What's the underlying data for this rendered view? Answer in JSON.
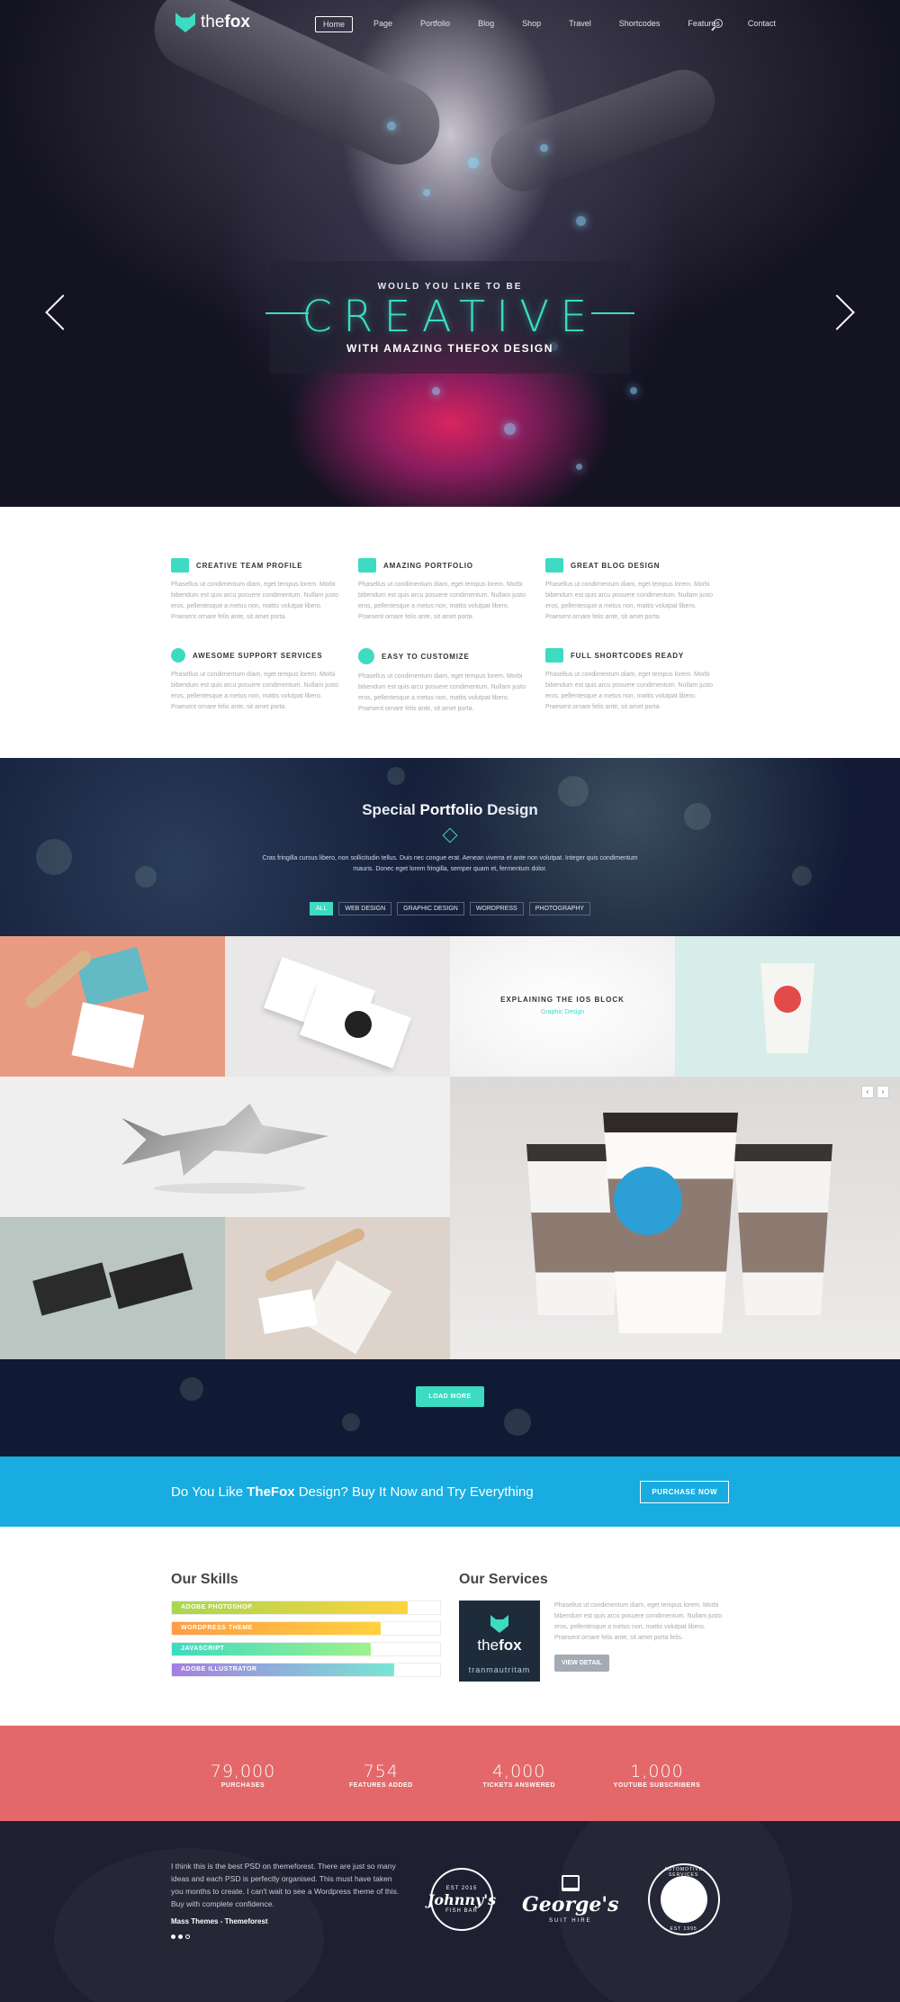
{
  "brand": {
    "logo_text_bold": "the",
    "logo_text": "fox"
  },
  "nav": {
    "items": [
      "Home",
      "Page",
      "Portfolio",
      "Blog",
      "Shop",
      "Travel",
      "Shortcodes",
      "Features",
      "Contact"
    ],
    "active": "Home"
  },
  "hero": {
    "pre_title": "WOULD YOU LIKE TO BE",
    "title": "CREATIVE",
    "subtitle": "WITH AMAZING THEFOX DESIGN"
  },
  "features": [
    {
      "icon": "team-icon",
      "title": "CREATIVE TEAM PROFILE",
      "text": "Phasellus ut condimentum diam, eget tempus lorem. Morbi bibendum est quis arcu posuere condimentum. Nullam justo eros, pellentesque a metus non, mattis volutpat libero. Praesent ornare felis ante, sit amet porta."
    },
    {
      "icon": "cube-icon",
      "title": "AMAZING PORTFOLIO",
      "text": "Phasellus ut condimentum diam, eget tempus lorem. Morbi bibendum est quis arcu posuere condimentum. Nullam justo eros, pellentesque a metus non, mattis volutpat libero. Praesent ornare felis ante, sit amet porta."
    },
    {
      "icon": "camera-icon",
      "title": "GREAT BLOG DESIGN",
      "text": "Phasellus ut condimentum diam, eget tempus lorem. Morbi bibendum est quis arcu posuere condimentum. Nullam justo eros, pellentesque a metus non, mattis volutpat libero. Praesent ornare felis ante, sit amet porta."
    },
    {
      "icon": "magnifier-icon",
      "title": "AWESOME SUPPORT SERVICES",
      "text": "Phasellus ut condimentum diam, eget tempus lorem. Morbi bibendum est quis arcu posuere condimentum. Nullam justo eros, pellentesque a metus non, mattis volutpat libero. Praesent ornare felis ante, sit amet porta."
    },
    {
      "icon": "gear-icon",
      "title": "EASY TO CUSTOMIZE",
      "text": "Phasellus ut condimentum diam, eget tempus lorem. Morbi bibendum est quis arcu posuere condimentum. Nullam justo eros, pellentesque a metus non, mattis volutpat libero. Praesent ornare felis ante, sit amet porta."
    },
    {
      "icon": "chat-icon",
      "title": "FULL SHORTCODES READY",
      "text": "Phasellus ut condimentum diam, eget tempus lorem. Morbi bibendum est quis arcu posuere condimentum. Nullam justo eros, pellentesque a metus non, mattis volutpat libero. Praesent ornare felis ante, sit amet porta."
    }
  ],
  "portfolio": {
    "title_light": "Special ",
    "title_bold": "Portfolio",
    "title_tail": " Design",
    "text": "Cras fringilla cursus libero, non sollicitudin tellus. Duis nec congue erat. Aenean viverra et ante non volutpat. Integer quis condimentum mauris. Donec eget lorem fringilla, semper quam et, fermentum dolor.",
    "filters": [
      "ALL",
      "WEB DESIGN",
      "GRAPHIC DESIGN",
      "WORDPRESS",
      "PHOTOGRAPHY"
    ],
    "active_filter": "ALL",
    "hover_tile": {
      "title": "EXPLAINING THE IOS BLOCK",
      "category": "Graphic Design"
    },
    "load_more": "LOAD MORE"
  },
  "cta": {
    "text_pre": "Do You Like ",
    "text_bold": "TheFox",
    "text_post": " Design? Buy It Now and Try Everything",
    "button": "PURCHASE NOW"
  },
  "skills": {
    "title_light": "Our ",
    "title_bold": "Skills",
    "bars": [
      {
        "label": "ADOBE PHOTOSHOP",
        "percent": 88,
        "from": "#a6d84f",
        "to": "#ffd23f"
      },
      {
        "label": "WORDPRESS THEME",
        "percent": 78,
        "from": "#ff9c45",
        "to": "#ffd23f"
      },
      {
        "label": "JAVASCRIPT",
        "percent": 74,
        "from": "#3ddbc1",
        "to": "#9ff28a"
      },
      {
        "label": "ADOBE ILLUSTRATOR",
        "percent": 83,
        "from": "#a57ee0",
        "to": "#79e6d4"
      }
    ]
  },
  "services": {
    "title_light": "Our ",
    "title_bold": "Services",
    "image_title_light": "the",
    "image_title_bold": "fox",
    "image_tag": "tranmautritam",
    "text": "Phasellus ut condimentum diam, eget tempus lorem. Morbi bibendum est quis arcu posuere condimentum. Nullam justo eros, pellentesque a metus non, mattis volutpat libero. Praesent ornare felis ante, sit amet porta felis.",
    "button": "VIEW DETAIL"
  },
  "stats": [
    {
      "value": "79,000",
      "label": "PURCHASES"
    },
    {
      "value": "754",
      "label": "FEATURES ADDED"
    },
    {
      "value": "4,000",
      "label": "TICKETS ANSWERED"
    },
    {
      "value": "1,000",
      "label": "YOUTUBE SUBSCRIBERS"
    }
  ],
  "testimonial": {
    "quote": "I think this is the best PSD on themeforest. There are just so many ideas and each PSD is perfectly organised. This must have taken you months to create. I can't wait to see a Wordpress theme of this. Buy with complete confidence.",
    "author": "Mass Themes - Themeforest",
    "brands": [
      {
        "name": "Johnny's",
        "sub": "FISH BAR",
        "top": "EST 2015"
      },
      {
        "name": "George's",
        "sub": "SUIT HIRE"
      },
      {
        "name": "AUTOMOTIVE SERVICES",
        "sub": "EST 1995"
      }
    ]
  },
  "colors": {
    "accent": "#3ddbc1",
    "cta": "#18ace0",
    "stats": "#e4686a",
    "dark": "#1e1f30"
  }
}
